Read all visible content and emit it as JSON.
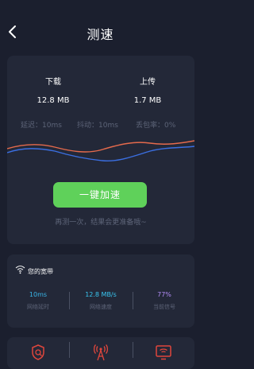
{
  "header": {
    "title": "测速",
    "back_icon": "chevron-left-icon"
  },
  "speed": {
    "download_label": "下载",
    "download_value": "12.8 MB",
    "upload_label": "上传",
    "upload_value": "1.7 MB",
    "latency": "延迟：10ms",
    "jitter": "抖动：10ms",
    "packet_loss": "丢包率：0%",
    "boost_button": "一键加速",
    "hint": "再测一次，结果会更准备哦~",
    "colors": {
      "download_line": "#e56a4c",
      "upload_line": "#3b6fe2",
      "button": "#5fd15a"
    }
  },
  "network": {
    "title": "您的宽带",
    "items": [
      {
        "value": "10ms",
        "label": "网络延时",
        "color": "#39b6e8"
      },
      {
        "value": "12.8 MB/s",
        "label": "网络速度",
        "color": "#39c6f0"
      },
      {
        "value": "77%",
        "label": "当前信号",
        "color": "#b08bf3"
      }
    ]
  },
  "tools": [
    {
      "icon": "shield-search-icon"
    },
    {
      "icon": "signal-tower-icon"
    },
    {
      "icon": "monitor-wifi-icon"
    }
  ]
}
